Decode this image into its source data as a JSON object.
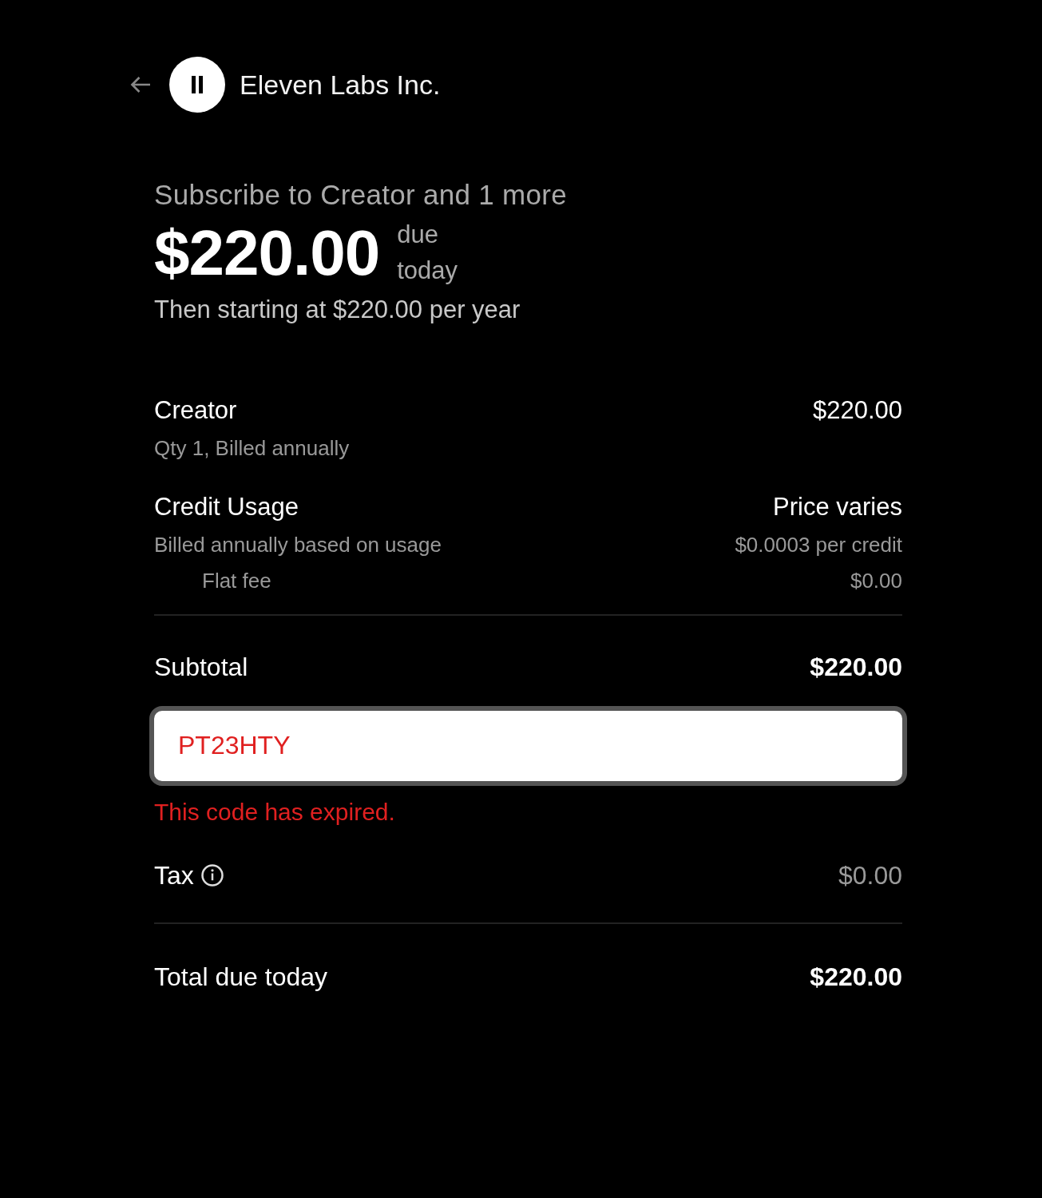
{
  "header": {
    "merchant": "Eleven Labs Inc."
  },
  "summary": {
    "title": "Subscribe to Creator and 1 more",
    "amount": "$220.00",
    "due": "due today",
    "recurring": "Then starting at $220.00 per year"
  },
  "line_items": [
    {
      "name": "Creator",
      "detail": "Qty 1, Billed annually",
      "price": "$220.00"
    },
    {
      "name": "Credit Usage",
      "detail": "Billed annually based on usage",
      "price": "Price varies",
      "rate": "$0.0003 per credit",
      "sub_detail": "Flat fee",
      "sub_price": "$0.00"
    }
  ],
  "subtotal": {
    "label": "Subtotal",
    "value": "$220.00"
  },
  "promo": {
    "value": "PT23HTY",
    "error": "This code has expired.",
    "invalid": true
  },
  "tax": {
    "label": "Tax",
    "value": "$0.00"
  },
  "total": {
    "label": "Total due today",
    "value": "$220.00"
  }
}
